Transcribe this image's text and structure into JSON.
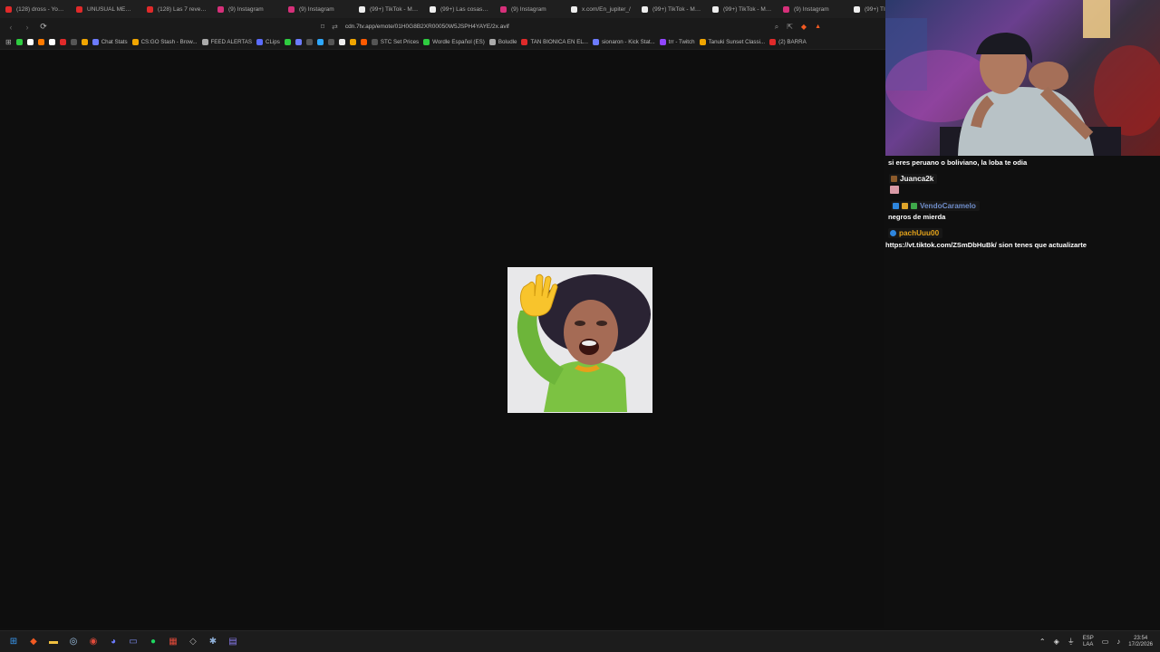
{
  "browser": {
    "tabs": [
      {
        "title": "(128) dross - YouTu",
        "icon": "youtube-icon",
        "color": "#e02a2a"
      },
      {
        "title": "UNUSUAL MEMES",
        "icon": "youtube-icon",
        "color": "#e02a2a"
      },
      {
        "title": "(128) Las 7 revelaci",
        "icon": "youtube-icon",
        "color": "#e02a2a"
      },
      {
        "title": "(9) Instagram",
        "icon": "instagram-icon",
        "color": "#d6307a"
      },
      {
        "title": "(9) Instagram",
        "icon": "instagram-icon",
        "color": "#d6307a"
      },
      {
        "title": "(99+) TikTok - Make",
        "icon": "tiktok-icon",
        "color": "#eeeeee"
      },
      {
        "title": "(99+) Las cosas bon",
        "icon": "tiktok-icon",
        "color": "#eeeeee"
      },
      {
        "title": "(9) Instagram",
        "icon": "instagram-icon",
        "color": "#d6307a"
      },
      {
        "title": "x.com/En_jupiter_/",
        "icon": "x-icon",
        "color": "#eeeeee"
      },
      {
        "title": "(99+) TikTok - Make",
        "icon": "tiktok-icon",
        "color": "#eeeeee"
      },
      {
        "title": "(99+) TikTok - Make",
        "icon": "tiktok-icon",
        "color": "#eeeeee"
      },
      {
        "title": "(9) Instagram",
        "icon": "instagram-icon",
        "color": "#d6307a"
      },
      {
        "title": "(99+) TI",
        "icon": "tiktok-icon",
        "color": "#eeeeee"
      }
    ],
    "url": "cdn.7tv.app/emote/01H0G8B2XR00050W5JSPH4YAYE/2x.avif",
    "bookmarks": [
      {
        "label": "",
        "color": "#2ecc40"
      },
      {
        "label": "",
        "color": "#ffffff"
      },
      {
        "label": "",
        "color": "#ff7a00"
      },
      {
        "label": "",
        "color": "#ffffff"
      },
      {
        "label": "",
        "color": "#e02a2a"
      },
      {
        "label": "",
        "color": "#555555"
      },
      {
        "label": "",
        "color": "#f0a500"
      },
      {
        "label": "Chat Stats",
        "color": "#6c7bff"
      },
      {
        "label": "CS:GO Stash - Brow...",
        "color": "#f0a500"
      },
      {
        "label": "FEED ALERTAS",
        "color": "#aaaaaa"
      },
      {
        "label": "CLips",
        "color": "#5b6cff"
      },
      {
        "label": "",
        "color": "#2ecc40"
      },
      {
        "label": "",
        "color": "#6c7bff"
      },
      {
        "label": "",
        "color": "#555555"
      },
      {
        "label": "",
        "color": "#2ea8ff"
      },
      {
        "label": "",
        "color": "#555555"
      },
      {
        "label": "",
        "color": "#eeeeee"
      },
      {
        "label": "",
        "color": "#f0a500"
      },
      {
        "label": "",
        "color": "#ff5a00"
      },
      {
        "label": "STC Set Prices",
        "color": "#555555"
      },
      {
        "label": "Wordle Español (ES)",
        "color": "#2ecc40"
      },
      {
        "label": "Boludle",
        "color": "#aaaaaa"
      },
      {
        "label": "TAN BIONICA EN EL...",
        "color": "#e02a2a"
      },
      {
        "label": "sionaron - Kick Stat...",
        "color": "#6c7bff"
      },
      {
        "label": "trr - Twitch",
        "color": "#9146ff"
      },
      {
        "label": "Tanuki Sunset Classi...",
        "color": "#f0a500"
      },
      {
        "label": "(2) BARRA",
        "color": "#e02a2a"
      }
    ]
  },
  "chat": {
    "messages": [
      {
        "type": "text",
        "text": "si eres peruano o boliviano, la loba te odia"
      },
      {
        "type": "user",
        "username": "Juanca2k",
        "color": "#f2f2f2"
      },
      {
        "type": "user",
        "username": "VendoCaramelo",
        "color": "#6f8dc9"
      },
      {
        "type": "text",
        "text": "negros de mierda"
      },
      {
        "type": "user",
        "username": "pachUuu00",
        "color": "#e3a21a"
      },
      {
        "type": "text",
        "text": "https://vt.tiktok.com/ZSmDbHuBk/ sion tenes que actualizarte"
      }
    ]
  },
  "taskbar": {
    "apps": [
      "windows-start-icon",
      "brave-icon",
      "file-explorer-icon",
      "steam-icon",
      "chrome-icon",
      "discord-icon",
      "app-window-icon",
      "spotify-icon",
      "calendar-icon",
      "epic-icon",
      "settings-icon",
      "notes-icon"
    ],
    "language": "ESP",
    "language_sub": "LAA",
    "time": "23:54",
    "date": "17/2/2026"
  }
}
